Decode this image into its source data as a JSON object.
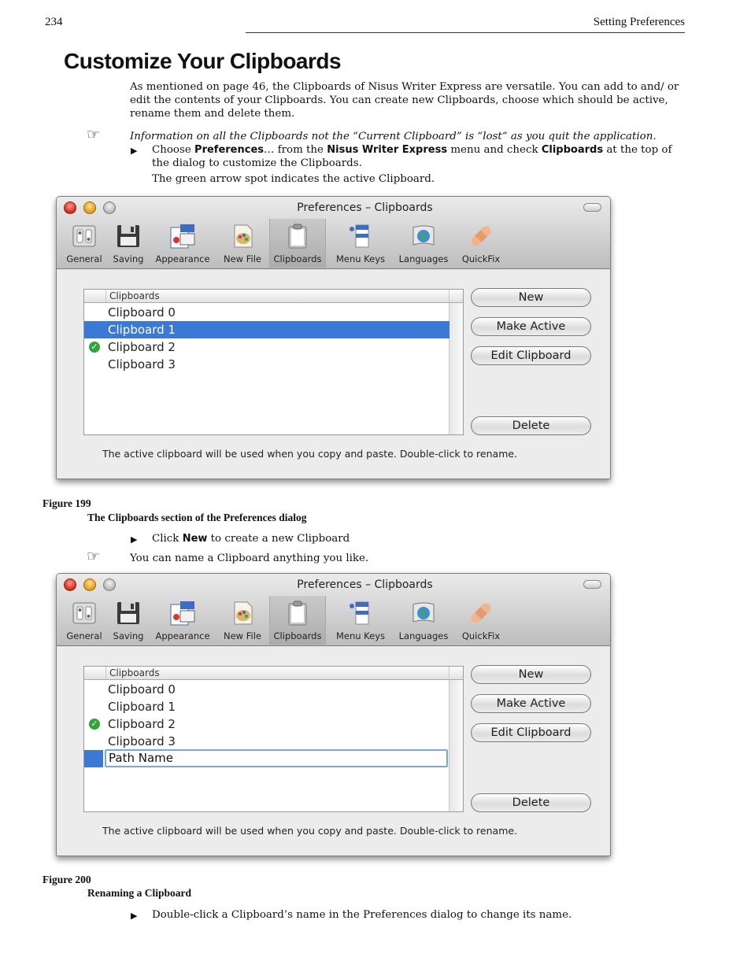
{
  "header": {
    "page_number": "234",
    "section": "Setting Preferences"
  },
  "title": "Customize Your Clipboards",
  "intro": "As mentioned on page 46, the Clipboards of Nisus Writer Express are versatile. You can add to and/ or edit the contents of your Clipboards. You can create new Clipboards, choose which should be active, rename them and delete them.",
  "note1": "Information on all the Clipboards not the “Current Clipboard” is “lost” as you quit the application.",
  "step1": {
    "p1": "Choose ",
    "ui1": "Preferences",
    "p2": "… from the ",
    "ui2": "Nisus Writer Express",
    "p3": " menu and check ",
    "ui3": "Clipboards",
    "p4": " at the top of the dialog to customize the Clipboards."
  },
  "step1_followup": "The green arrow spot indicates the active Clipboard.",
  "window": {
    "title": "Preferences – Clipboards",
    "toolbar": [
      "General",
      "Saving",
      "Appearance",
      "New File",
      "Clipboards",
      "Menu Keys",
      "Languages",
      "QuickFix"
    ],
    "list_header": "Clipboards",
    "buttons": {
      "new": "New",
      "make_active": "Make Active",
      "edit": "Edit Clipboard",
      "delete": "Delete"
    },
    "hint": "The active clipboard will be used when you copy and paste.  Double-click to rename."
  },
  "figure1": {
    "label": "Figure 199",
    "caption": "The Clipboards section of the Preferences dialog",
    "rows": [
      "Clipboard 0",
      "Clipboard 1",
      "Clipboard 2",
      "Clipboard 3"
    ]
  },
  "step2": {
    "p1": "Click ",
    "ui1": "New",
    "p2": " to create a new Clipboard"
  },
  "note2": "You can name a Clipboard anything you like.",
  "figure2": {
    "label": "Figure 200",
    "caption": "Renaming a Clipboard",
    "rows": [
      "Clipboard 0",
      "Clipboard 1",
      "Clipboard 2",
      "Clipboard 3"
    ],
    "edit_value": "Path Name"
  },
  "step3": "Double-click a Clipboard’s name in the Preferences dialog to change its name.",
  "symbols": {
    "note": "☞",
    "bullet": "▶",
    "check": "✓"
  },
  "colors": {
    "selection": "#3a7ad6",
    "active_check": "#2fa53a"
  }
}
